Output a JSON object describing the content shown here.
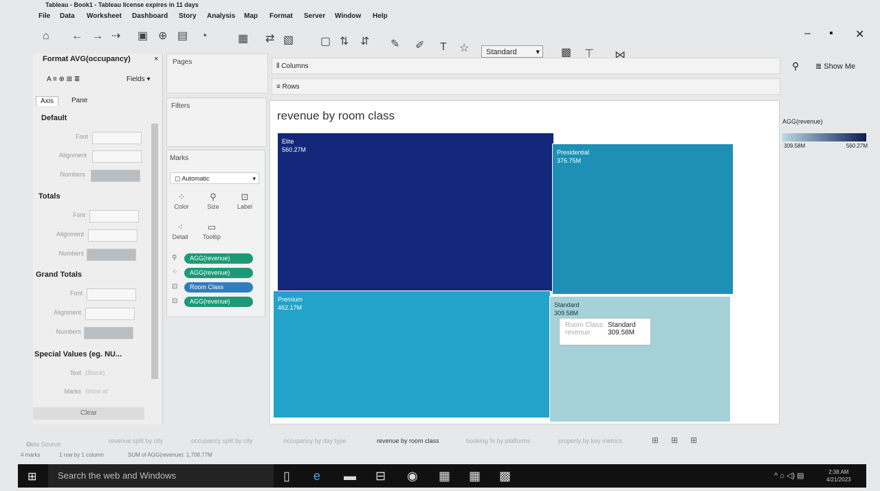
{
  "window": {
    "title": "Tableau - Book1 - Tableau license expires in 11 days"
  },
  "menu": [
    "File",
    "Data",
    "Worksheet",
    "Dashboard",
    "Story",
    "Analysis",
    "Map",
    "Format",
    "Server",
    "Window",
    "Help"
  ],
  "toolbar": {
    "standard_select": "Standard",
    "show_me": "Show Me"
  },
  "format_pane": {
    "title": "Format AVG(occupancy)",
    "close": "×",
    "fields_label": "Fields ▾",
    "tabs": [
      "Axis",
      "Pane"
    ],
    "sections": {
      "default": "Default",
      "totals": "Totals",
      "grand_totals": "Grand Totals",
      "special_values": "Special Values (eg. NU..."
    },
    "labels": {
      "font": "Font",
      "alignment": "Alignment",
      "numbers": "Numbers",
      "text": "Text",
      "marks": "Marks"
    },
    "special_text_value": "(Blank)",
    "special_marks_value": "Show at",
    "clear_button": "Clear"
  },
  "side_cards": {
    "pages": "Pages",
    "filters": "Filters",
    "marks": "Marks",
    "mark_type": "Automatic",
    "buttons": {
      "color": "Color",
      "size": "Size",
      "label": "Label",
      "detail": "Detail",
      "tooltip": "Tooltip"
    },
    "pills": [
      "AGG(revenue)",
      "AGG(revenue)",
      "Room Class",
      "AGG(revenue)"
    ]
  },
  "shelves": {
    "columns": "Columns",
    "rows": "Rows"
  },
  "view": {
    "title": "revenue by room class"
  },
  "treemap": [
    {
      "name": "Elite",
      "value": "560.27M"
    },
    {
      "name": "Presidential",
      "value": "376.75M"
    },
    {
      "name": "Premium",
      "value": "462.17M"
    },
    {
      "name": "Standard",
      "value": "309.58M"
    }
  ],
  "treemap_colors": {
    "elite": "#13287a",
    "presidential": "#1e8fb5",
    "premium": "#23a3c9",
    "standard": "#a4d2d8"
  },
  "tooltip": {
    "room_class_label": "Room Class:",
    "room_class_value": "Standard",
    "revenue_label": "revenue:",
    "revenue_value": "309.58M"
  },
  "legend": {
    "title": "AGG(revenue)",
    "min": "309.58M",
    "max": "560.27M"
  },
  "sheet_tabs": [
    "Data Source",
    "revenue split by city",
    "occupancy split by city",
    "occupancy by day type",
    "revenue by room class",
    "booking % by platforms",
    "property by key metrics"
  ],
  "active_sheet": "revenue by room class",
  "status_bar": {
    "marks": "4 marks",
    "rows": "1 row by 1 column",
    "sum": "SUM of AGG(revenue): 1,708.77M"
  },
  "taskbar": {
    "search_placeholder": "Search the web and Windows",
    "time": "2:38 AM",
    "date": "4/21/2023"
  }
}
